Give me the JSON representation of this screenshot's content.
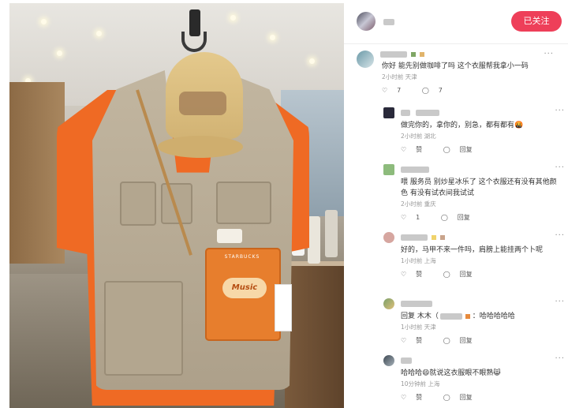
{
  "header": {
    "follow_label": "已关注"
  },
  "comments": [
    {
      "text": "你好 能先别做咖啡了吗 这个衣服帮我拿小一码",
      "meta": "2小时前 天津",
      "likes": "7",
      "replies": "7"
    },
    {
      "text": "做完你的，拿你的，别急，都有都有🤬",
      "meta": "2小时前 湖北",
      "like_label": "赞",
      "reply_label": "回复"
    },
    {
      "text": "喂 服务员 别炒星冰乐了 这个衣服还有没有其他颜色 有没有试衣间我试试",
      "meta": "2小时前 重庆",
      "likes": "1",
      "reply_label": "回复"
    },
    {
      "text": "好的，马甲不来一件吗，肩膀上能挂两个卜呢",
      "meta": "1小时前 上海",
      "like_label": "赞",
      "reply_label": "回复"
    },
    {
      "prefix": "回复 木木（",
      "suffix": "：哈哈哈哈哈",
      "meta": "1小时前 天津",
      "like_label": "赞",
      "reply_label": "回复"
    },
    {
      "text": "哈哈哈😄就说这衣服眼不眼熟😸",
      "meta": "10分钟前 上海",
      "like_label": "赞",
      "reply_label": "回复"
    }
  ],
  "photo": {
    "bag_label": "STARBUCKS",
    "bag_logo": "Music"
  },
  "colors": {
    "follow_button": "#ee3f59",
    "shirt": "#ef6a24",
    "vest": "#c2b6a0",
    "cap": "#e4c98c",
    "bag": "#e77e2d"
  }
}
